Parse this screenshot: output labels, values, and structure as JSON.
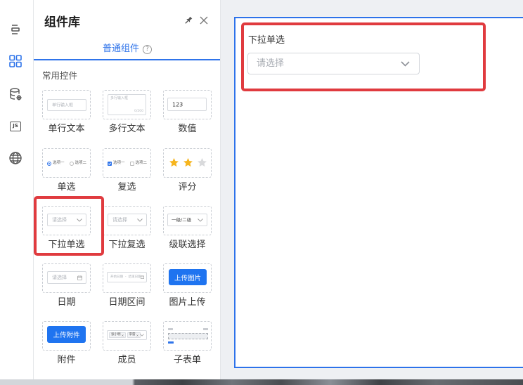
{
  "rail": {
    "items": [
      {
        "icon": "outline-icon"
      },
      {
        "icon": "grid-icon",
        "active": true
      },
      {
        "icon": "database-settings-icon"
      },
      {
        "icon": "js-icon",
        "label": "JS"
      },
      {
        "icon": "globe-icon"
      }
    ]
  },
  "panel": {
    "title": "组件库",
    "tab_label": "普通组件",
    "tab_help": "?",
    "section_title": "常用控件",
    "components": [
      {
        "label": "单行文本",
        "preview": {
          "placeholder": "单行输入框"
        }
      },
      {
        "label": "多行文本",
        "preview": {
          "placeholder": "多行输入框",
          "count": "0/200"
        }
      },
      {
        "label": "数值",
        "preview": {
          "value": "123"
        }
      },
      {
        "label": "单选",
        "preview": {
          "options": [
            "选项一",
            "选项二"
          ],
          "selected": 0
        }
      },
      {
        "label": "复选",
        "preview": {
          "options": [
            "选项一",
            "选项二"
          ],
          "checked": [
            0
          ]
        }
      },
      {
        "label": "评分",
        "preview": {
          "rating": 2,
          "max": 3
        }
      },
      {
        "label": "下拉单选",
        "preview": {
          "placeholder": "请选择"
        }
      },
      {
        "label": "下拉复选",
        "preview": {
          "placeholder": "请选择"
        }
      },
      {
        "label": "级联选择",
        "preview": {
          "value": "一级/二级"
        }
      },
      {
        "label": "日期",
        "preview": {
          "placeholder": "请选择"
        }
      },
      {
        "label": "日期区间",
        "preview": {
          "start": "开始日期",
          "separator": "-",
          "end": "结束日期"
        }
      },
      {
        "label": "图片上传",
        "preview": {
          "button": "上传图片"
        }
      },
      {
        "label": "附件",
        "preview": {
          "button": "上传附件"
        }
      },
      {
        "label": "成员",
        "preview": {
          "tags": [
            "张小明",
            "李雷"
          ]
        }
      },
      {
        "label": "子表单"
      }
    ]
  },
  "canvas": {
    "field_label": "下拉单选",
    "select_placeholder": "请选择"
  },
  "colors": {
    "accent": "#2f74ea",
    "highlight": "#e03b3f",
    "star_on": "#f6b51e",
    "star_off": "#d9dadc",
    "canvas_bg": "#eef0f3"
  }
}
